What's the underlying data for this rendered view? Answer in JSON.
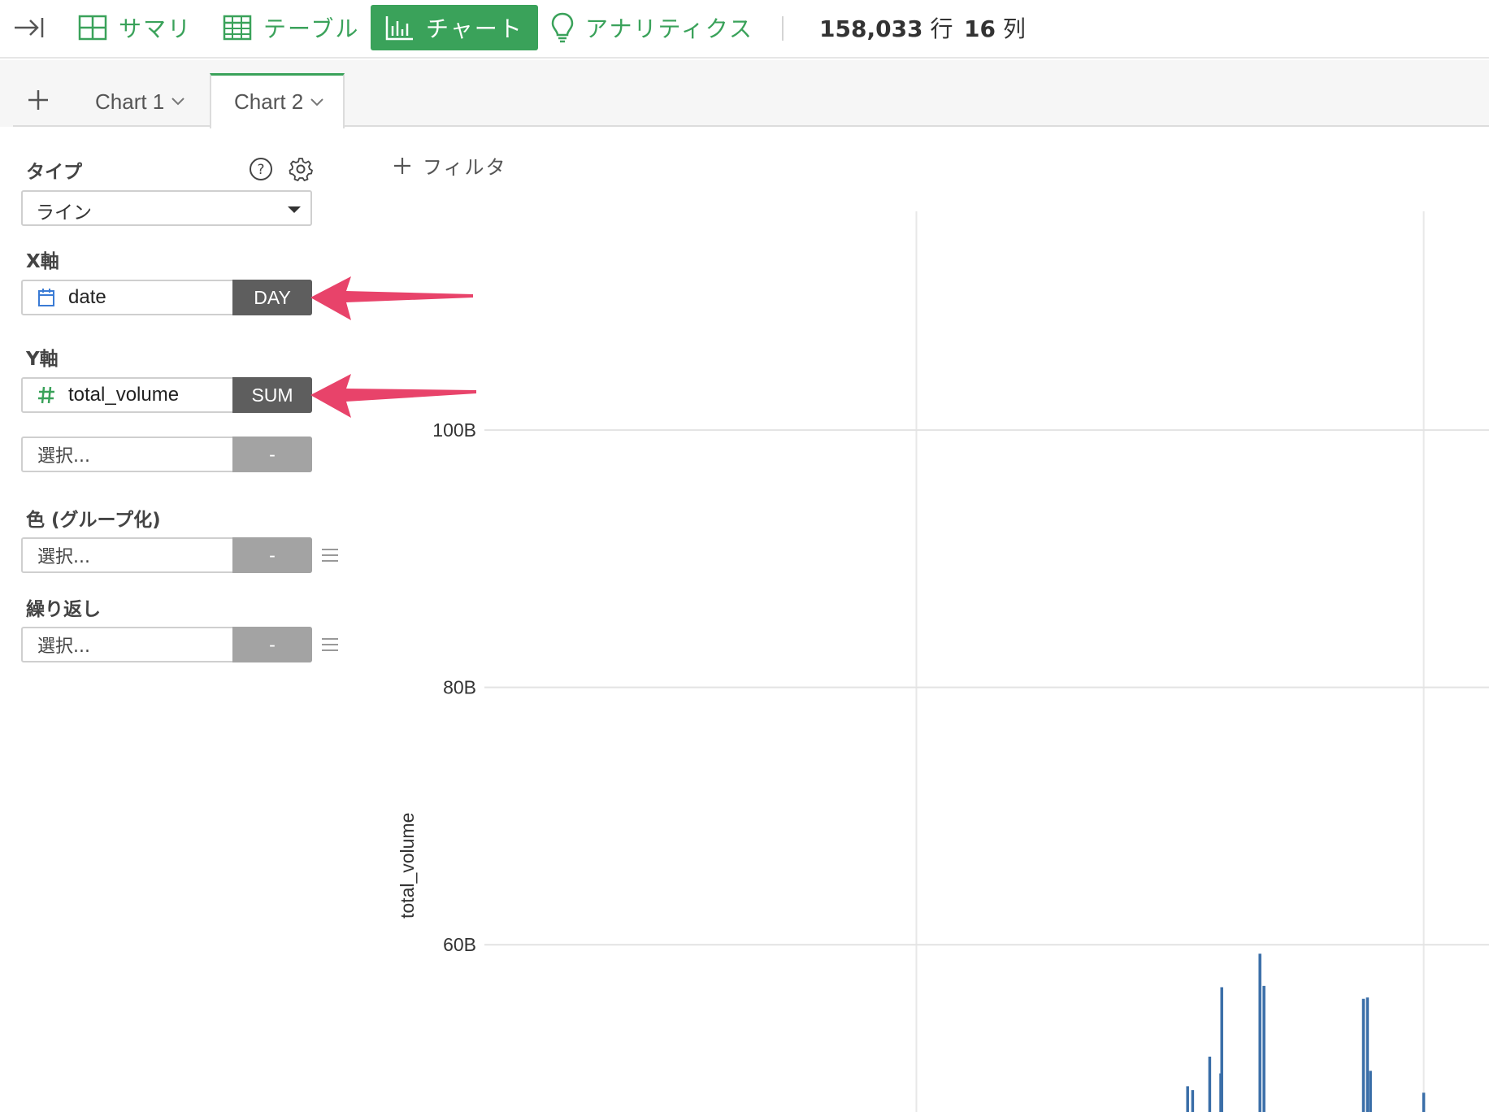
{
  "toolbar": {
    "nav": [
      {
        "label": "サマリ",
        "icon": "summary-grid-icon",
        "active": false
      },
      {
        "label": "テーブル",
        "icon": "table-icon",
        "active": false
      },
      {
        "label": "チャート",
        "icon": "bar-chart-icon",
        "active": true
      },
      {
        "label": "アナリティクス",
        "icon": "lightbulb-icon",
        "active": false
      }
    ],
    "rows_value": "158,033",
    "rows_unit": "行",
    "cols_value": "16",
    "cols_unit": "列"
  },
  "tabs": [
    {
      "label": "Chart 1",
      "active": false
    },
    {
      "label": "Chart 2",
      "active": true
    }
  ],
  "panel": {
    "type_label": "タイプ",
    "type_value": "ライン",
    "x_label": "X軸",
    "x_field": "date",
    "x_agg": "DAY",
    "y_label": "Y軸",
    "y_field": "total_volume",
    "y_agg": "SUM",
    "y2_placeholder": "選択...",
    "y2_agg": "-",
    "color_label": "色 (グループ化)",
    "color_placeholder": "選択...",
    "color_agg": "-",
    "repeat_label": "繰り返し",
    "repeat_placeholder": "選択...",
    "repeat_agg": "-"
  },
  "filter_label": "フィルタ",
  "colors": {
    "accent": "#3aa25a",
    "series": "#3a6ea8",
    "annotation": "#e8436a",
    "agg_active": "#5e5e5e",
    "agg_empty": "#a3a3a3"
  },
  "chart_data": {
    "type": "line",
    "ylabel": "total_volume",
    "y_ticks": [
      {
        "value": 60000000000,
        "label": "60B"
      },
      {
        "value": 80000000000,
        "label": "80B"
      },
      {
        "value": 100000000000,
        "label": "100B"
      }
    ],
    "ylim": [
      47000000000,
      117000000000
    ],
    "grid": true,
    "series": [
      {
        "color": "#3a6ea8",
        "spikes": [
          {
            "position": 0.7,
            "value": 49000000000
          },
          {
            "position": 0.705,
            "value": 48700000000
          },
          {
            "position": 0.722,
            "value": 51300000000
          },
          {
            "position": 0.733,
            "value": 50000000000
          },
          {
            "position": 0.734,
            "value": 56700000000
          },
          {
            "position": 0.772,
            "value": 59300000000
          },
          {
            "position": 0.776,
            "value": 56800000000
          },
          {
            "position": 0.875,
            "value": 55800000000
          },
          {
            "position": 0.879,
            "value": 55900000000
          },
          {
            "position": 0.882,
            "value": 50200000000
          },
          {
            "position": 0.935,
            "value": 48500000000
          }
        ]
      }
    ]
  }
}
